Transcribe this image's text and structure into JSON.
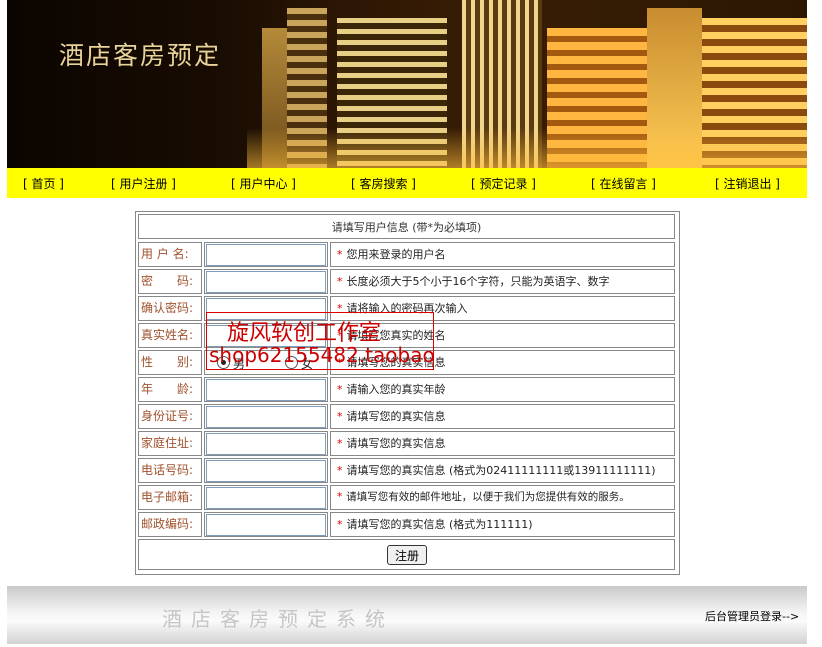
{
  "banner": {
    "title": "酒店客房预定"
  },
  "nav": [
    "[ 首页 ]",
    "[ 用户注册 ]",
    "[ 用户中心 ]",
    "[ 客房搜索 ]",
    "[ 预定记录 ]",
    "[ 在线留言 ]",
    "[ 注销退出 ]"
  ],
  "form": {
    "header": "请填写用户信息 (带*为必填项)",
    "rows": [
      {
        "label": "用 户 名:",
        "hint": "您用来登录的用户名"
      },
      {
        "label": "密　　码:",
        "hint": "长度必须大于5个小于16个字符，只能为英语字、数字"
      },
      {
        "label": "确认密码:",
        "hint": "请将输入的密码再次输入"
      },
      {
        "label": "真实姓名:",
        "hint": "请填写您真实的姓名"
      },
      {
        "label": "性　　别:",
        "hint": "请填写您的真实信息"
      },
      {
        "label": "年　　龄:",
        "hint": "请输入您的真实年龄"
      },
      {
        "label": "身份证号:",
        "hint": "请填写您的真实信息"
      },
      {
        "label": "家庭住址:",
        "hint": "请填写您的真实信息"
      },
      {
        "label": "电话号码:",
        "hint": "请填写您的真实信息 (格式为02411111111或13911111111)"
      },
      {
        "label": "电子邮箱:",
        "hint": "请填写您有效的邮件地址，以便于我们为您提供有效的服务。"
      },
      {
        "label": "邮政编码:",
        "hint": "请填写您的真实信息 (格式为111111)"
      }
    ],
    "gender": {
      "male": "男",
      "female": "女",
      "selected": "男"
    },
    "required_mark": "*",
    "submit": "注册"
  },
  "watermark": {
    "line1": "旋风软创工作室",
    "line2": "shop62155482.taobao"
  },
  "footer": {
    "title": "酒店客房预定系统",
    "admin_link": "后台管理员登录-->"
  },
  "colors": {
    "nav_bg": "#ffff00",
    "label": "#a0522d",
    "required": "#dd0000",
    "watermark": "#cc0000"
  }
}
